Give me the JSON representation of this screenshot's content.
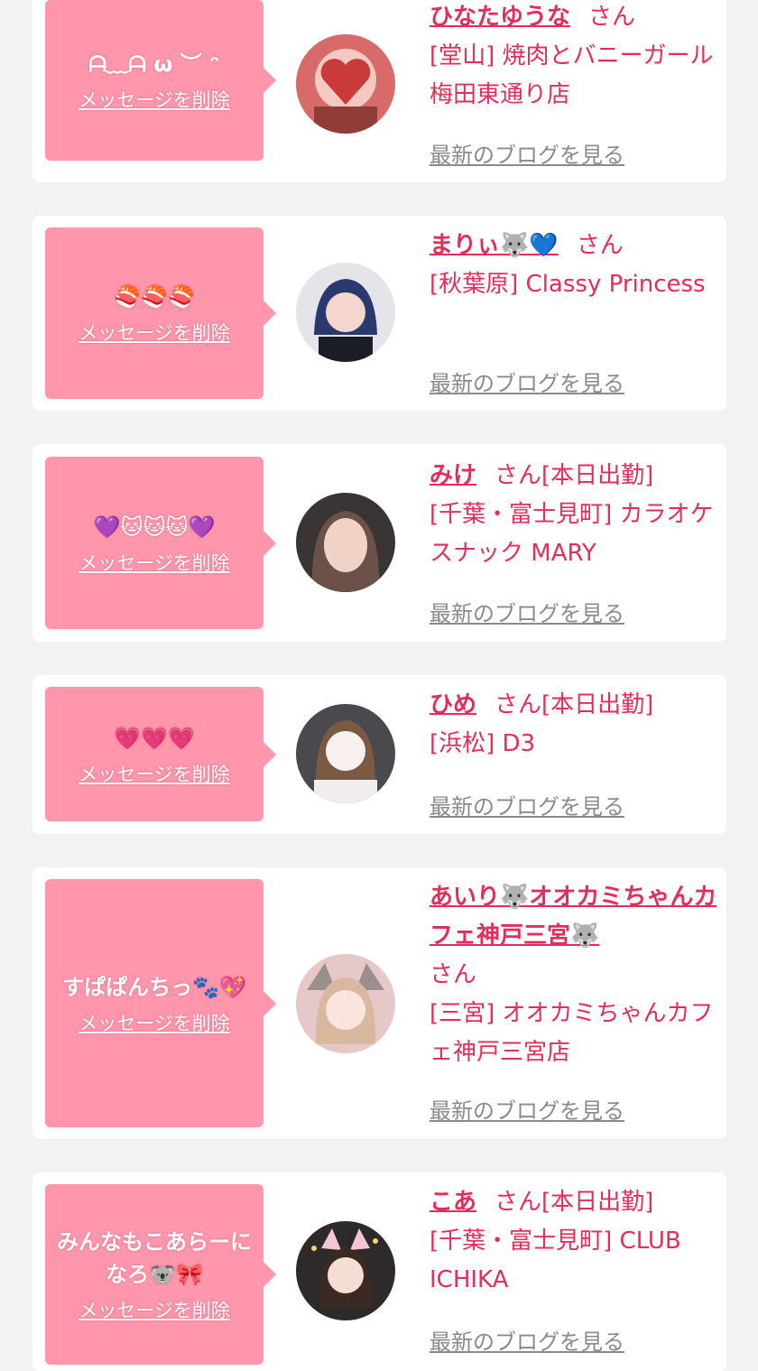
{
  "delete_label": "メッセージを削除",
  "blog_label": "最新のブログを見る",
  "honorific": "さん",
  "cards": [
    {
      "message": "ᗩ﹏ᗩ ω ︶ ᵔ",
      "name": "ひなたゆうな",
      "status": "",
      "shop": "[堂山] 焼肉とバニーガール梅田東通り店"
    },
    {
      "message": "🍣🍣🍣",
      "name": "まりぃ🐺💙",
      "status": "",
      "shop": "[秋葉原] Classy Princess"
    },
    {
      "message": "💜🐱🐱🐱💜",
      "name": "みけ",
      "status": "[本日出勤]",
      "shop": "[千葉・富士見町] カラオケスナック MARY"
    },
    {
      "message": "💗💗💗",
      "name": "ひめ",
      "status": "[本日出勤]",
      "shop": "[浜松] D3"
    },
    {
      "message": "すぱぱんちっ🐾💖",
      "name": "あいり🐺オオカミちゃんカフェ神戸三宮🐺",
      "status": "",
      "shop": "[三宮] オオカミちゃんカフェ神戸三宮店"
    },
    {
      "message": "みんなもこあらーになろ🐨🎀",
      "name": "こあ",
      "status": "[本日出勤]",
      "shop": "[千葉・富士見町] CLUB ICHIKA"
    }
  ]
}
